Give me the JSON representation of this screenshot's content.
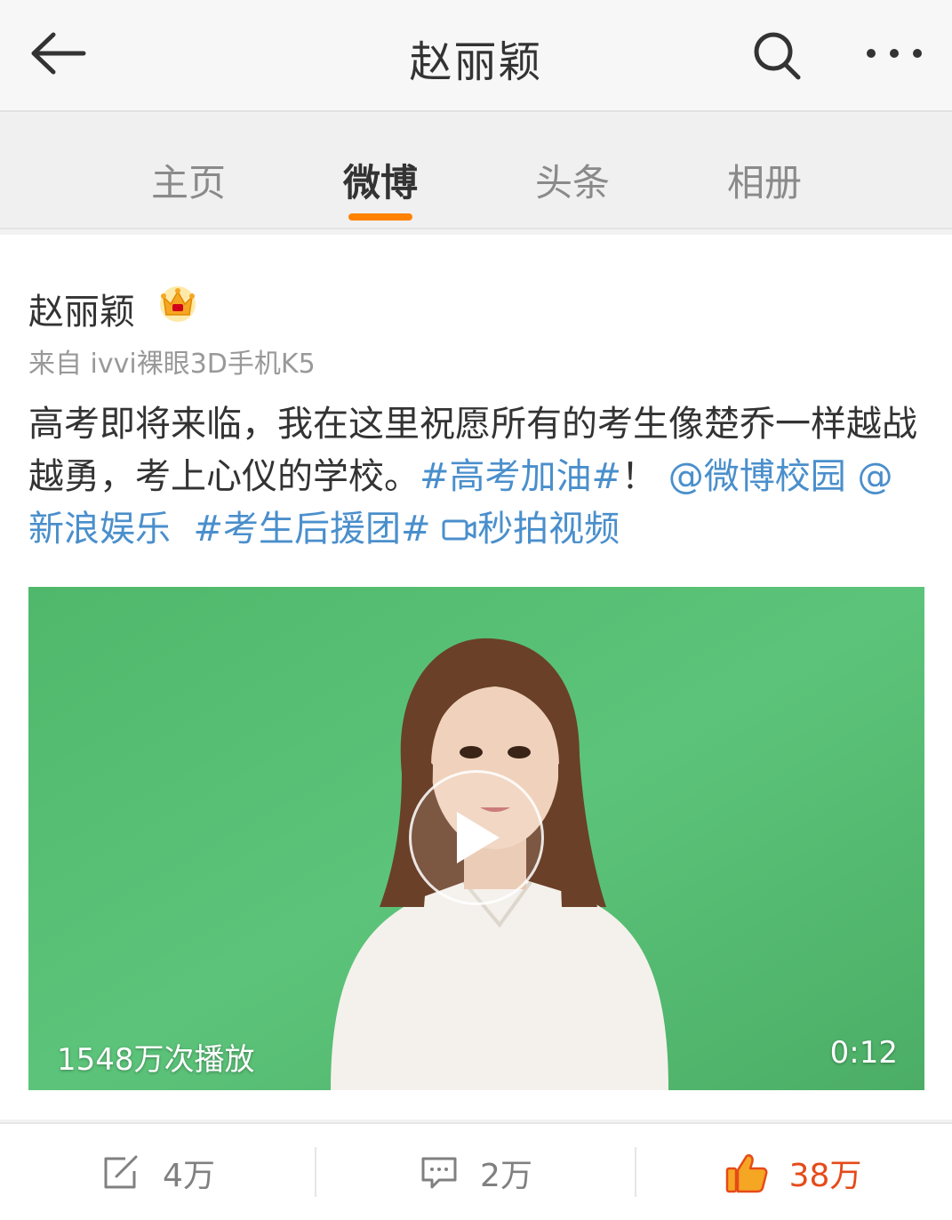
{
  "header": {
    "title": "赵丽颖",
    "back_icon": "arrow-left-icon",
    "search_icon": "search-icon",
    "more_icon": "more-dots-icon"
  },
  "tabs": [
    {
      "label": "主页",
      "active": false
    },
    {
      "label": "微博",
      "active": true
    },
    {
      "label": "头条",
      "active": false
    },
    {
      "label": "相册",
      "active": false
    }
  ],
  "accent_color": "#ff8200",
  "link_color": "#4a8fcc",
  "post": {
    "author": "赵丽颖",
    "badge_icon": "crown-icon",
    "source": "来自 ivvi裸眼3D手机K5",
    "text_plain": "高考即将来临，我在这里祝愿所有的考生像楚乔一样越战越勇，考上心仪的学校。",
    "hashtag_1": "#高考加油#",
    "after_hashtag": "！",
    "mention_1": "@微博校园",
    "mention_2": "@新浪娱乐",
    "hashtag_2": "#考生后援团#",
    "video_link": "秒拍视频",
    "video": {
      "views": "1548万次播放",
      "duration": "0:12",
      "play_icon": "play-icon"
    }
  },
  "actions": {
    "repost_count": "4万",
    "comment_count": "2万",
    "like_count": "38万",
    "repost_icon": "share-edit-icon",
    "comment_icon": "comment-icon",
    "like_icon": "thumbs-up-icon"
  }
}
